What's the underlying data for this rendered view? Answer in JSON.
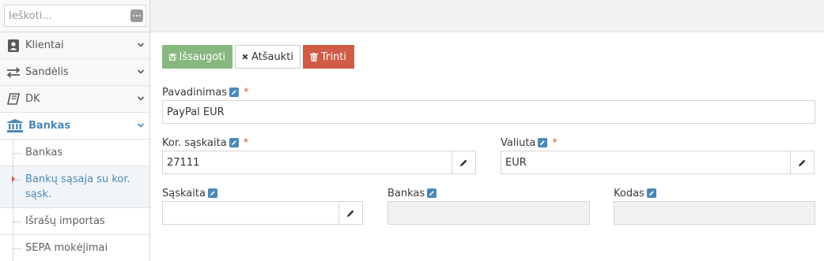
{
  "search": {
    "placeholder": "Ieškoti..."
  },
  "sidebar": {
    "items": [
      {
        "label": "Klientai"
      },
      {
        "label": "Sandėlis"
      },
      {
        "label": "DK"
      },
      {
        "label": "Bankas"
      }
    ],
    "subitems": [
      {
        "label": "Bankas"
      },
      {
        "label": "Bankų sąsaja su kor. sąsk."
      },
      {
        "label": "Išrašų importas"
      },
      {
        "label": "SEPA mokėjimai"
      }
    ]
  },
  "toolbar": {
    "save_label": "Išsaugoti",
    "cancel_label": "Atšaukti",
    "delete_label": "Trinti"
  },
  "form": {
    "name_label": "Pavadinimas",
    "name_value": "PayPal EUR",
    "kor_label": "Kor. sąskaita",
    "kor_value": "27111",
    "currency_label": "Valiuta",
    "currency_value": "EUR",
    "account_label": "Sąskaita",
    "account_value": "",
    "bank_label": "Bankas",
    "bank_value": "",
    "code_label": "Kodas",
    "code_value": "",
    "required_mark": "*"
  },
  "colors": {
    "accent": "#4b88b7",
    "save": "#87b87f",
    "delete": "#d15b47"
  }
}
